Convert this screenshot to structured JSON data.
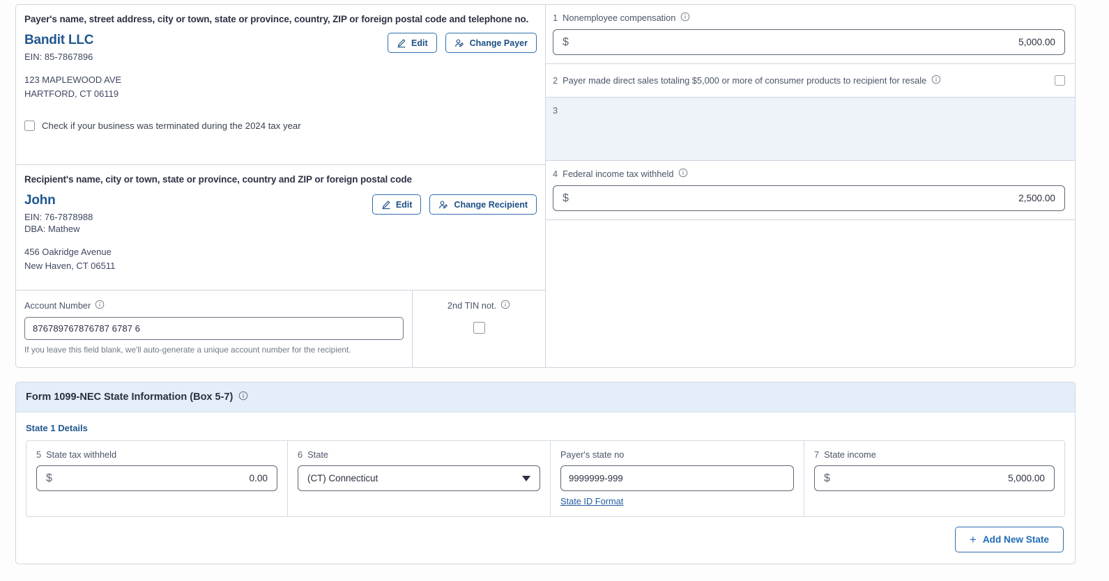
{
  "payer": {
    "caption": "Payer's name, street address, city or town, state or province, country, ZIP or foreign postal code and telephone no.",
    "name": "Bandit LLC",
    "ein": "EIN: 85-7867896",
    "address_line1": "123 MAPLEWOOD AVE",
    "address_line2": "HARTFORD, CT 06119",
    "edit_label": "Edit",
    "change_label": "Change Payer",
    "terminated_checkbox_label": "Check if your business was terminated during the 2024 tax year",
    "terminated_checked": false
  },
  "recipient": {
    "caption": "Recipient's name, city or town, state or province, country and ZIP or foreign postal code",
    "name": "John",
    "ein": "EIN: 76-7878988",
    "dba": "DBA: Mathew",
    "address_line1": "456 Oakridge Avenue",
    "address_line2": "New Haven, CT 06511",
    "edit_label": "Edit",
    "change_label": "Change Recipient"
  },
  "account": {
    "label": "Account Number",
    "value": "876789767876787 6787 6",
    "helper": "If you leave this field blank, we'll auto-generate a unique account number for the recipient.",
    "tin_label": "2nd TIN not.",
    "tin_checked": false
  },
  "boxes": {
    "box1": {
      "num": "1",
      "label": "Nonemployee compensation",
      "currency": "$",
      "value": "5,000.00"
    },
    "box2": {
      "num": "2",
      "label": "Payer made direct sales totaling $5,000 or more of consumer products to recipient for resale",
      "checked": false
    },
    "box3": {
      "num": "3",
      "label": ""
    },
    "box4": {
      "num": "4",
      "label": "Federal income tax withheld",
      "currency": "$",
      "value": "2,500.00"
    }
  },
  "state_section": {
    "title": "Form 1099-NEC  State Information  (Box 5-7)",
    "subtitle": "State 1 Details",
    "box5": {
      "num": "5",
      "label": "State tax withheld",
      "currency": "$",
      "value": "0.00"
    },
    "box6": {
      "num": "6",
      "label": "State",
      "selected": "(CT) Connecticut"
    },
    "payer_state_no": {
      "label": "Payer's state no",
      "value": "9999999-999",
      "link": "State ID Format"
    },
    "box7": {
      "num": "7",
      "label": "State income",
      "currency": "$",
      "value": "5,000.00"
    },
    "add_button": {
      "plus": "+",
      "label": "Add New State"
    }
  },
  "colors": {
    "accent_blue": "#20578f",
    "link_blue": "#1f5c9e",
    "header_bg": "#e4eefa",
    "disabled_bg": "#eef2f9",
    "border": "#cfd6e0"
  },
  "icons": {
    "info": "info-circle-icon",
    "edit": "pencil-icon",
    "change_person": "person-edit-icon",
    "dropdown": "chevron-down-icon",
    "add": "plus-icon"
  }
}
